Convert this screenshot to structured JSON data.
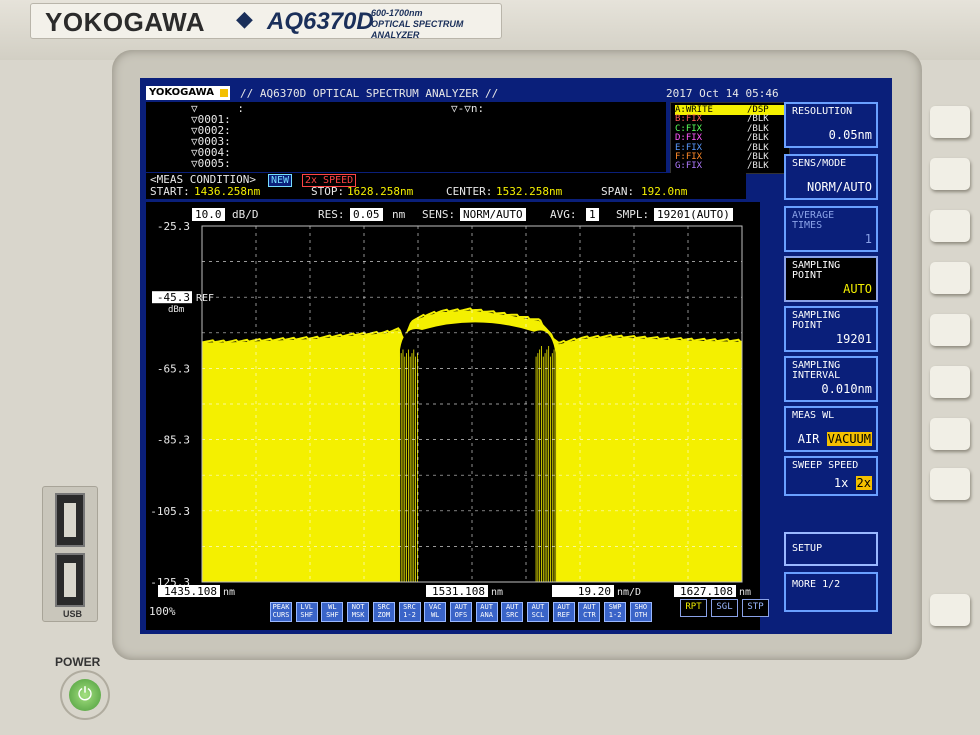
{
  "device": {
    "brand": "YOKOGAWA",
    "model": "AQ6370D",
    "subtitle_line1": "600-1700nm",
    "subtitle_line2": "OPTICAL SPECTRUM ANALYZER",
    "usb_label": "USB",
    "power_label": "POWER"
  },
  "header": {
    "logo": "YOKOGAWA",
    "title": "// AQ6370D OPTICAL SPECTRUM ANALYZER //",
    "datetime": "2017 Oct 14 05:46"
  },
  "markers": {
    "rows": [
      "▽      :",
      "▽0001:",
      "▽0002:",
      "▽0003:",
      "▽0004:",
      "▽0005:"
    ],
    "delta_label": "▽-▽n:"
  },
  "traces": [
    {
      "name": "A:WRITE",
      "mode": "/DSP",
      "color": "#000000",
      "active": true
    },
    {
      "name": "B:FIX",
      "mode": "/BLK",
      "color": "#ff5a5a",
      "active": false
    },
    {
      "name": "C:FIX",
      "mode": "/BLK",
      "color": "#5aff5a",
      "active": false
    },
    {
      "name": "D:FIX",
      "mode": "/BLK",
      "color": "#ff5aff",
      "active": false
    },
    {
      "name": "E:FIX",
      "mode": "/BLK",
      "color": "#5a9aff",
      "active": false
    },
    {
      "name": "F:FIX",
      "mode": "/BLK",
      "color": "#ff8a2a",
      "active": false
    },
    {
      "name": "G:FIX",
      "mode": "/BLK",
      "color": "#b07aff",
      "active": false
    }
  ],
  "meas": {
    "condition_label": "<MEAS CONDITION>",
    "badge_new": "NEW",
    "badge_speed": "2x SPEED",
    "start_label": "START:",
    "start": "1436.258nm",
    "stop_label": "STOP:",
    "stop": "1628.258nm",
    "center_label": "CENTER:",
    "center": "1532.258nm",
    "span_label": "SPAN:",
    "span": "192.0nm"
  },
  "plot_header": {
    "scale": "10.0",
    "scale_unit": "dB/D",
    "res_label": "RES:",
    "res": "0.05",
    "res_unit": "nm",
    "sens_label": "SENS:",
    "sens": "NORM/AUTO",
    "avg_label": "AVG:",
    "avg": "1",
    "smpl_label": "SMPL:",
    "smpl": "19201(AUTO)"
  },
  "axes": {
    "y_ticks": [
      "-25.3",
      "-45.3",
      "-65.3",
      "-85.3",
      "-105.3",
      "-125.3"
    ],
    "ref_label": "REF",
    "y_unit": "dBm",
    "x_left": "1435.108",
    "x_center": "1531.108",
    "x_right": "1627.108",
    "x_unit": "nm",
    "x_div": "19.20",
    "x_div_unit": "nm/D"
  },
  "chart_data": {
    "type": "area",
    "xlim": [
      1435.108,
      1627.108
    ],
    "ylim": [
      -125.3,
      -25.3
    ],
    "x_div": 19.2,
    "y_div": 10.0,
    "series": [
      {
        "color": "#f4f000",
        "x": [
          1435.1,
          1445,
          1460,
          1475,
          1490,
          1500,
          1505,
          1507,
          1510,
          1515,
          1520,
          1531,
          1545,
          1555,
          1560,
          1562,
          1570,
          1580,
          1595,
          1610,
          1627.1
        ],
        "values": [
          -58,
          -58,
          -57.5,
          -57,
          -56,
          -55.5,
          -54.5,
          -57.5,
          -52,
          -50.5,
          -49.5,
          -49,
          -50.5,
          -52,
          -57,
          -58.5,
          -57,
          -56.5,
          -57,
          -57.5,
          -57.8
        ],
        "notch_floor": -125.3,
        "notch_x_range": [
          1505.5,
          1561
        ]
      }
    ],
    "grid": true
  },
  "bottom": {
    "zoom_label": "100%",
    "keys": [
      {
        "l1": "PEAK",
        "l2": "CURS",
        "dim": false
      },
      {
        "l1": "LVL",
        "l2": "SHF",
        "dim": false
      },
      {
        "l1": "WL",
        "l2": "SHF",
        "dim": false
      },
      {
        "l1": "NOT",
        "l2": "MSK",
        "dim": false
      },
      {
        "l1": "SRC",
        "l2": "ZOM",
        "dim": false
      },
      {
        "l1": "SRC",
        "l2": "1-2",
        "dim": false
      },
      {
        "l1": "VAC",
        "l2": "WL",
        "dim": false
      },
      {
        "l1": "AUT",
        "l2": "OFS",
        "dim": false
      },
      {
        "l1": "AUT",
        "l2": "ANA",
        "dim": false
      },
      {
        "l1": "AUT",
        "l2": "SRC",
        "dim": false
      },
      {
        "l1": "AUT",
        "l2": "SCL",
        "dim": false
      },
      {
        "l1": "AUT",
        "l2": "REF",
        "dim": false
      },
      {
        "l1": "AUT",
        "l2": "CTR",
        "dim": false
      },
      {
        "l1": "SWP",
        "l2": "1-2",
        "dim": false
      },
      {
        "l1": "SHO",
        "l2": "OTH",
        "dim": false
      }
    ],
    "sweep_keys": [
      "RPT",
      "SGL",
      "STP"
    ]
  },
  "softkeys": [
    {
      "label": "RESOLUTION",
      "value": "0.05nm"
    },
    {
      "label": "SENS/MODE",
      "value": "NORM/AUTO"
    },
    {
      "label": "AVERAGE\nTIMES",
      "value": "1"
    },
    {
      "label": "SAMPLING\nPOINT",
      "value": "AUTO"
    },
    {
      "label": "SAMPLING\nPOINT",
      "value": "19201"
    },
    {
      "label": "SAMPLING\nINTERVAL",
      "value": "0.010nm"
    },
    {
      "label": "MEAS WL",
      "opt_a": "AIR",
      "opt_b": "VACUUM"
    },
    {
      "label": "SWEEP SPEED",
      "opt_a": "1x",
      "opt_b": "2x"
    },
    {
      "label": "SETUP",
      "value": ""
    },
    {
      "label": "MORE 1/2",
      "value": ""
    }
  ]
}
